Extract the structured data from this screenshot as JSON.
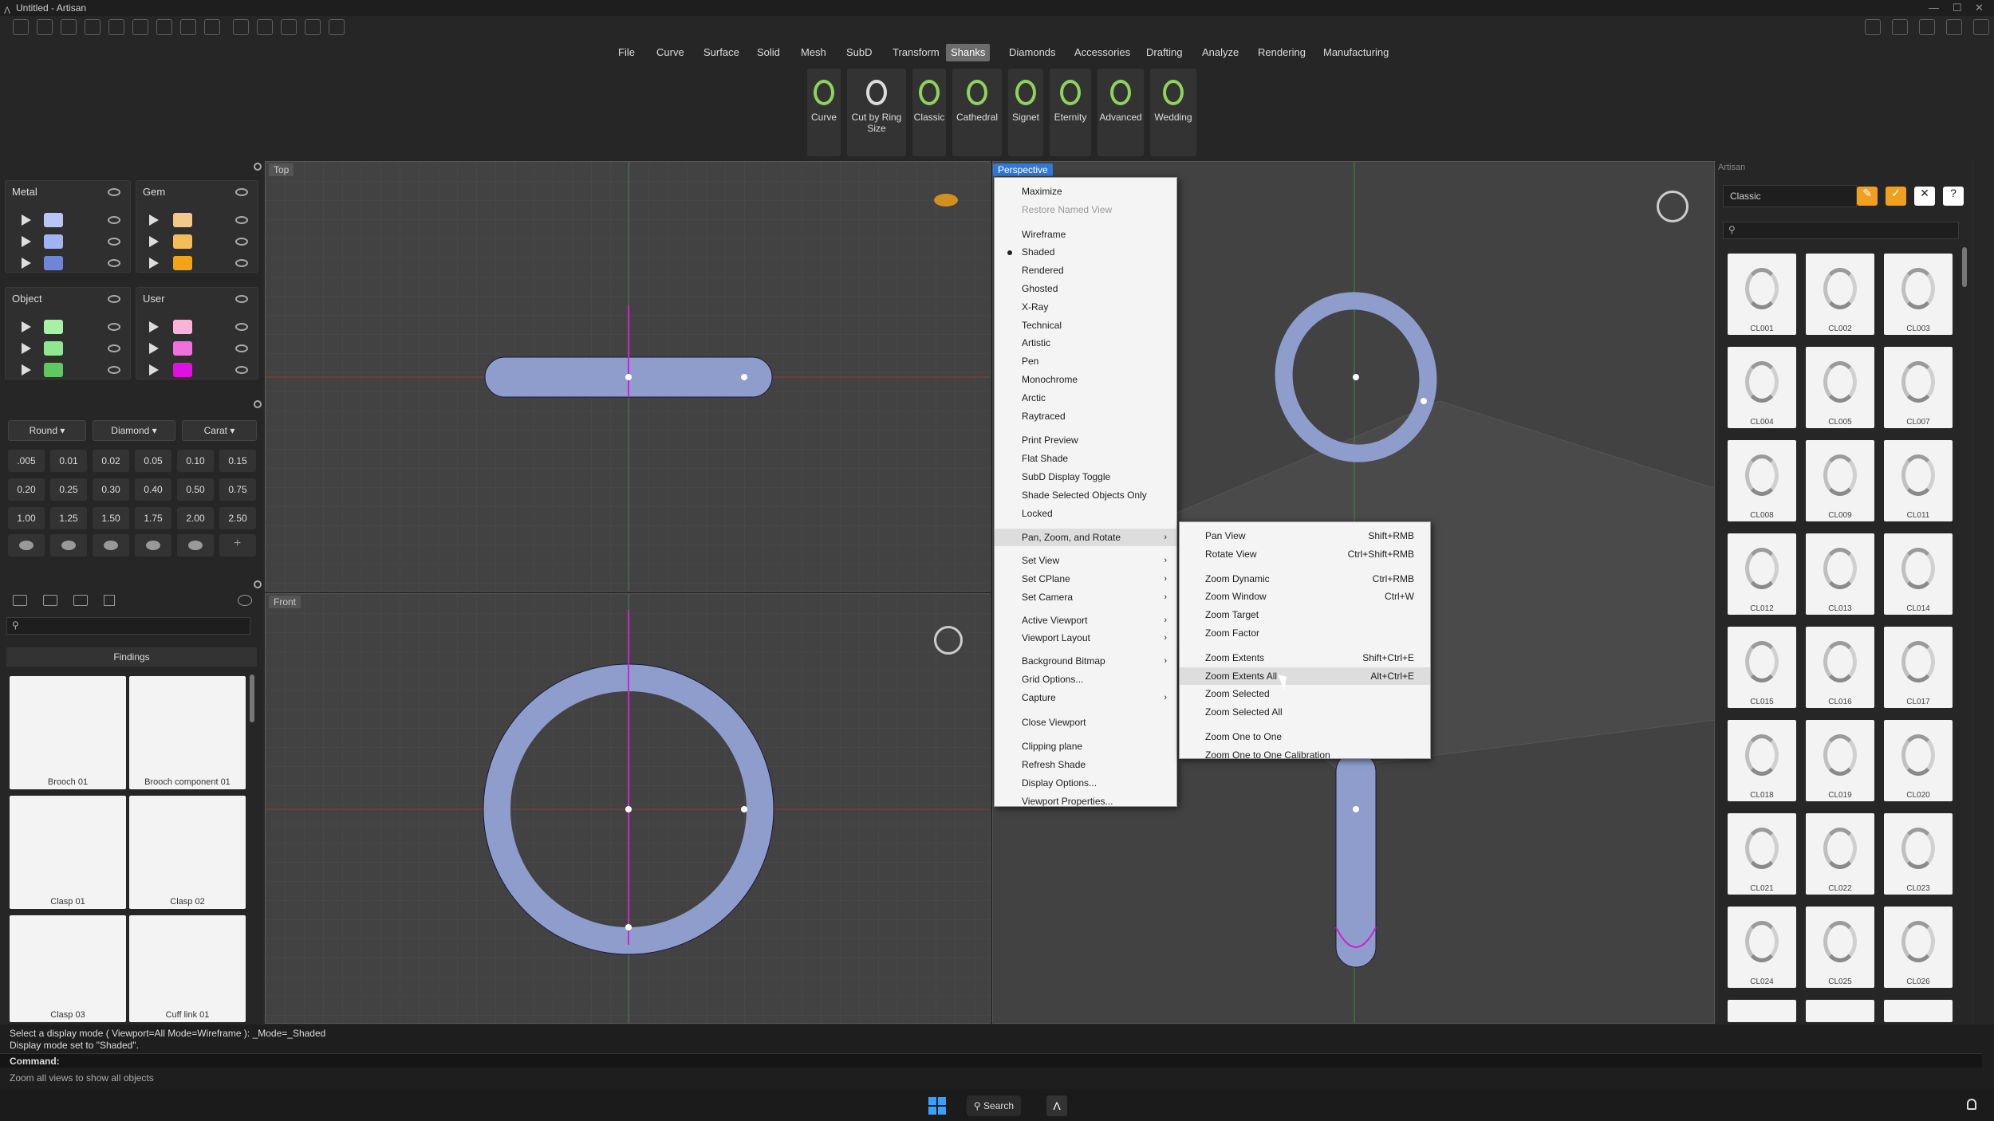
{
  "window": {
    "title": "Untitled - Artisan"
  },
  "menu": {
    "items": [
      "File",
      "Curve",
      "Surface",
      "Solid",
      "Mesh",
      "SubD",
      "Transform",
      "Shanks",
      "Diamonds",
      "Accessories",
      "Drafting",
      "Analyze",
      "Rendering",
      "Manufacturing"
    ],
    "active": "Shanks"
  },
  "ribbon": {
    "buttons": [
      "Curve",
      "Cut by Ring Size",
      "Classic",
      "Cathedral",
      "Signet",
      "Eternity",
      "Advanced",
      "Wedding"
    ]
  },
  "layers": {
    "metal": "Metal",
    "gem": "Gem",
    "object": "Object",
    "user": "User",
    "metal_colors": [
      "#b9c6f5",
      "#9fb4f0",
      "#6f86d8"
    ],
    "gem_colors": [
      "#f5c88a",
      "#f3bd58",
      "#f0a515"
    ],
    "object_colors": [
      "#a8f0a8",
      "#8fe88f",
      "#5fc85f"
    ],
    "user_colors": [
      "#f7b3d8",
      "#f070e0",
      "#e010e0"
    ]
  },
  "gems": {
    "shape": "Round",
    "material": "Diamond",
    "unit": "Carat",
    "sizes": [
      ".005",
      "0.01",
      "0.02",
      "0.05",
      "0.10",
      "0.15",
      "0.20",
      "0.25",
      "0.30",
      "0.40",
      "0.50",
      "0.75",
      "1.00",
      "1.25",
      "1.50",
      "1.75",
      "2.00",
      "2.50"
    ]
  },
  "findings": {
    "title": "Findings",
    "items": [
      "Brooch 01",
      "Brooch component 01",
      "Clasp 01",
      "Clasp 02",
      "Clasp 03",
      "Cuff link 01"
    ]
  },
  "viewports": {
    "top": "Top",
    "front": "Front",
    "perspective": "Perspective"
  },
  "context_menu": {
    "items": [
      {
        "label": "Maximize"
      },
      {
        "label": "Restore Named View",
        "disabled": true
      },
      {
        "label": "Wireframe"
      },
      {
        "label": "Shaded",
        "checked": true
      },
      {
        "label": "Rendered"
      },
      {
        "label": "Ghosted"
      },
      {
        "label": "X-Ray"
      },
      {
        "label": "Technical"
      },
      {
        "label": "Artistic"
      },
      {
        "label": "Pen"
      },
      {
        "label": "Monochrome"
      },
      {
        "label": "Arctic"
      },
      {
        "label": "Raytraced"
      },
      {
        "label": "Print Preview"
      },
      {
        "label": "Flat Shade"
      },
      {
        "label": "SubD Display Toggle"
      },
      {
        "label": "Shade Selected Objects Only"
      },
      {
        "label": "Locked"
      },
      {
        "label": "Pan, Zoom, and Rotate",
        "submenu": true,
        "highlight": true
      },
      {
        "label": "Set View",
        "submenu": true
      },
      {
        "label": "Set CPlane",
        "submenu": true
      },
      {
        "label": "Set Camera",
        "submenu": true
      },
      {
        "label": "Active Viewport",
        "submenu": true
      },
      {
        "label": "Viewport Layout",
        "submenu": true
      },
      {
        "label": "Background Bitmap",
        "submenu": true
      },
      {
        "label": "Grid Options..."
      },
      {
        "label": "Capture",
        "submenu": true
      },
      {
        "label": "Close Viewport"
      },
      {
        "label": "Clipping plane"
      },
      {
        "label": "Refresh Shade"
      },
      {
        "label": "Display Options..."
      },
      {
        "label": "Viewport Properties..."
      }
    ]
  },
  "submenu": {
    "items": [
      {
        "label": "Pan View",
        "shortcut": "Shift+RMB"
      },
      {
        "label": "Rotate View",
        "shortcut": "Ctrl+Shift+RMB"
      },
      {
        "label": "Zoom Dynamic",
        "shortcut": "Ctrl+RMB"
      },
      {
        "label": "Zoom Window",
        "shortcut": "Ctrl+W"
      },
      {
        "label": "Zoom Target",
        "shortcut": ""
      },
      {
        "label": "Zoom Factor",
        "shortcut": ""
      },
      {
        "label": "Zoom Extents",
        "shortcut": "Shift+Ctrl+E"
      },
      {
        "label": "Zoom Extents All",
        "shortcut": "Alt+Ctrl+E",
        "highlight": true
      },
      {
        "label": "Zoom Selected",
        "shortcut": ""
      },
      {
        "label": "Zoom Selected All",
        "shortcut": ""
      },
      {
        "label": "Zoom One to One",
        "shortcut": ""
      },
      {
        "label": "Zoom One to One Calibration",
        "shortcut": ""
      }
    ]
  },
  "library": {
    "title": "Artisan",
    "category": "Classic",
    "search_placeholder": "",
    "items": [
      "CL001",
      "CL002",
      "CL003",
      "CL004",
      "CL005",
      "CL007",
      "CL008",
      "CL009",
      "CL011",
      "CL012",
      "CL013",
      "CL014",
      "CL015",
      "CL016",
      "CL017",
      "CL018",
      "CL019",
      "CL020",
      "CL021",
      "CL022",
      "CL023",
      "CL024",
      "CL025",
      "CL026"
    ]
  },
  "status": {
    "line1": "Select a display mode ( Viewport=All  Mode=Wireframe ): _Mode=_Shaded",
    "line2": "Display mode set to \"Shaded\".",
    "command_label": "Command:",
    "hint": "Zoom all views to show all objects"
  },
  "taskbar": {
    "search": "Search"
  }
}
